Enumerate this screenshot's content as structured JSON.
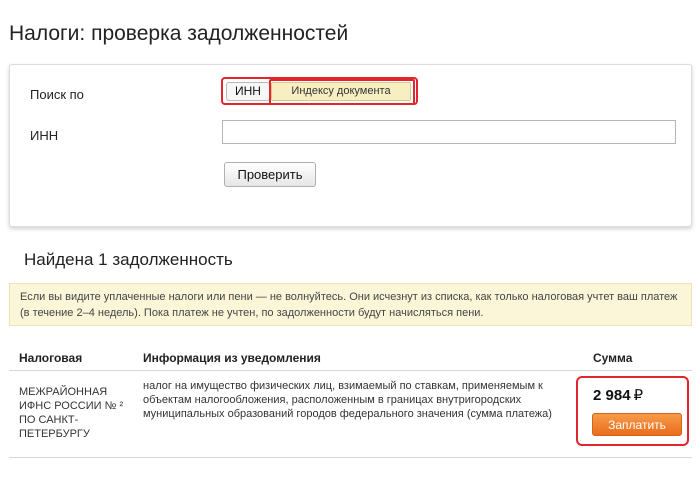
{
  "page": {
    "title": "Налоги: проверка задолженностей"
  },
  "search": {
    "label": "Поиск по",
    "options": [
      "ИНН",
      "Индексу документа"
    ],
    "inn_label": "ИНН",
    "inn_value": "",
    "check_button": "Проверить"
  },
  "results": {
    "found_title": "Найдена 1 задолженность",
    "notice": "Если вы видите уплаченные налоги или пени — не волнуйтесь. Они исчезнут из списка, как только налоговая учтет ваш платеж (в течение 2–4 недель). Пока платеж не учтен, по задолженности будут начисляться пени.",
    "columns": [
      "Налоговая",
      "Информация из уведомления",
      "Сумма"
    ],
    "rows": [
      {
        "tax_office": "МЕЖРАЙОННАЯ ИФНС РОССИИ № ² ПО САНКТ-ПЕТЕРБУРГУ",
        "info": "налог на имущество физических лиц, взимаемый по ставкам, применяемым к объектам налогообложения, расположенным в границах внутригородских муниципальных образований городов федерального значения (сумма платежа)",
        "amount": "2 984",
        "currency": "₽",
        "pay_button": "Заплатить"
      }
    ]
  },
  "colors": {
    "highlight": "#e2262d",
    "pay_button": "#ea6d1c",
    "notice_bg": "#fbf6d8",
    "selected_option_bg": "#f7efc1"
  }
}
